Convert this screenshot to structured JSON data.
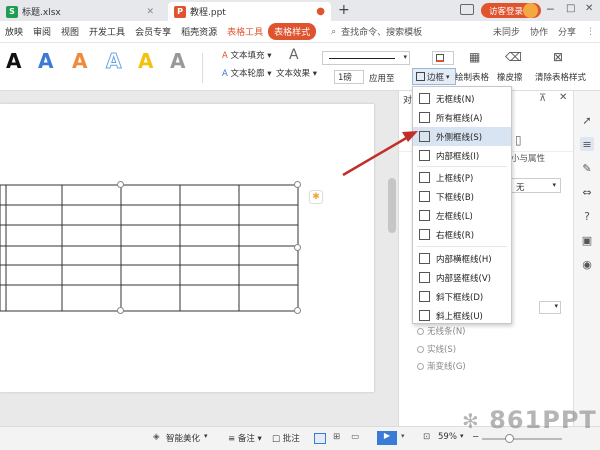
{
  "tabs": [
    {
      "label": "标题.xlsx",
      "icon": "S",
      "color": "#1f9d55"
    },
    {
      "label": "教程.ppt",
      "icon": "P",
      "color": "#e0532f"
    }
  ],
  "new_tab": "+",
  "user_button": "访客登录",
  "menu": [
    "放映",
    "审阅",
    "视图",
    "开发工具",
    "会员专享",
    "稻壳资源"
  ],
  "menu_context": [
    "表格工具",
    "表格样式"
  ],
  "search_placeholder": "查找命令、搜索模板",
  "sync_label": "未同步",
  "collab_label": "协作",
  "share_label": "分享",
  "ribbon": {
    "text_fill": "文本填充",
    "text_outline": "文本轮廓",
    "text_effect": "文本效果",
    "weight": "1磅",
    "apply_to": "应用至",
    "border": "边框",
    "draw_table": "绘制表格",
    "eraser": "橡皮擦",
    "clear_style": "清除表格样式"
  },
  "border_menu": [
    "无框线(N)",
    "所有框线(A)",
    "外侧框线(S)",
    "内部框线(I)",
    "上框线(P)",
    "下框线(B)",
    "左框线(L)",
    "右框线(R)",
    "内部横框线(H)",
    "内部竖框线(V)",
    "斜下框线(D)",
    "斜上框线(U)"
  ],
  "panel": {
    "title_char": "对",
    "tab_partial": "小与属性",
    "none_value": "无",
    "opt_none": "无线条(N)",
    "opt_solid": "实线(S)",
    "opt_gradient": "渐变线(G)"
  },
  "status": {
    "beautify": "智能美化",
    "notes": "备注",
    "comments": "批注",
    "zoom": "59%"
  },
  "watermark": "861PPT",
  "colors": {
    "accent": "#e0532f",
    "arrow": "#c0302a",
    "blue": "#3a7bd5"
  }
}
